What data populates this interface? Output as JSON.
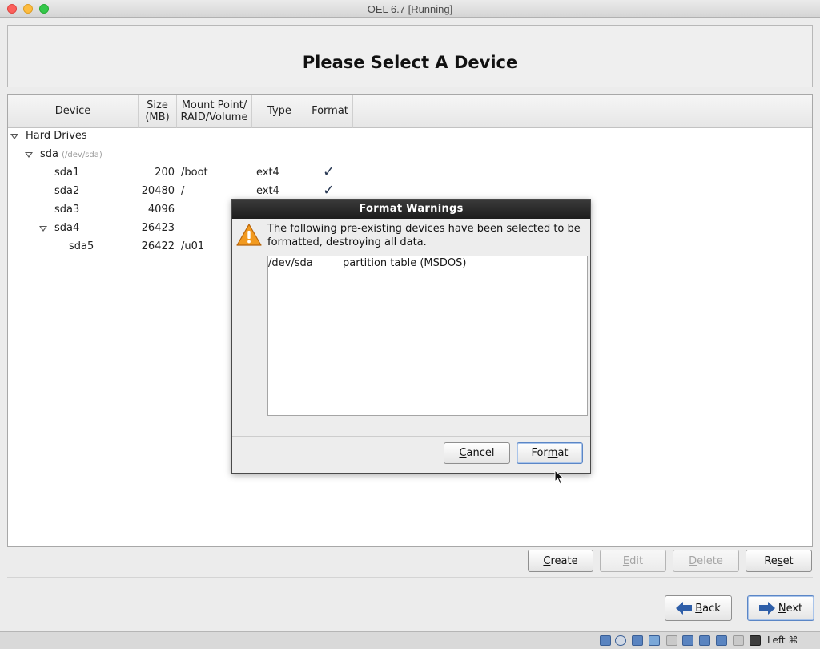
{
  "window": {
    "title": "OEL 6.7 [Running]"
  },
  "header": {
    "title": "Please Select A Device"
  },
  "columns": {
    "device": "Device",
    "size_line1": "Size",
    "size_line2": "(MB)",
    "mount_line1": "Mount Point/",
    "mount_line2": "RAID/Volume",
    "type": "Type",
    "format": "Format"
  },
  "tree": {
    "group_label": "Hard Drives",
    "disk": {
      "name": "sda",
      "path": "(/dev/sda)"
    },
    "partitions": [
      {
        "name": "sda1",
        "size": "200",
        "mount": "/boot",
        "type": "ext4",
        "format": true
      },
      {
        "name": "sda2",
        "size": "20480",
        "mount": "/",
        "type": "ext4",
        "format": true
      },
      {
        "name": "sda3",
        "size": "4096",
        "mount": "",
        "type": "",
        "format": false
      },
      {
        "name": "sda4",
        "size": "26423",
        "mount": "",
        "type": "",
        "format": false
      },
      {
        "name": "sda5",
        "size": "26422",
        "mount": "/u01",
        "type": "",
        "format": false
      }
    ],
    "check_glyph": "✓"
  },
  "actions": {
    "create_prefix": "C",
    "create_rest": "reate",
    "edit_prefix": "E",
    "edit_rest": "dit",
    "delete_prefix": "D",
    "delete_rest": "elete",
    "reset_pre": "Re",
    "reset_u": "s",
    "reset_post": "et"
  },
  "nav": {
    "back_u": "B",
    "back_rest": "ack",
    "next_u": "N",
    "next_rest": "ext"
  },
  "dialog": {
    "title": "Format Warnings",
    "message": "The following pre-existing devices have been selected to be formatted, destroying all data.",
    "items": [
      {
        "device": "/dev/sda",
        "description": "partition table (MSDOS)"
      }
    ],
    "cancel_u": "C",
    "cancel_rest": "ancel",
    "format_pre": "For",
    "format_u": "m",
    "format_post": "at"
  },
  "statusbar": {
    "host_key": "Left ⌘"
  }
}
